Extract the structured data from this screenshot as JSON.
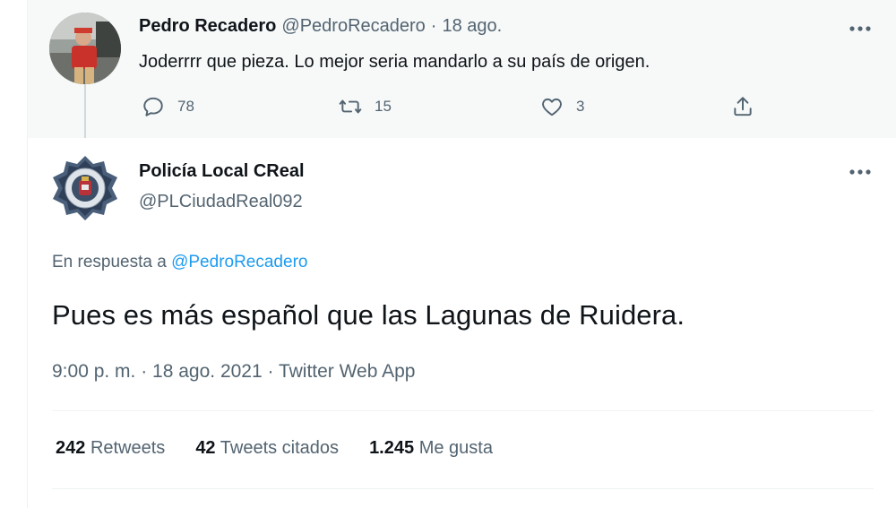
{
  "reply": {
    "author_name": "Pedro Recadero",
    "author_handle": "@PedroRecadero",
    "separator": "·",
    "date": "18 ago.",
    "text": "Joderrrr que pieza. Lo mejor seria mandarlo a su país de origen.",
    "reply_count": "78",
    "retweet_count": "15",
    "like_count": "3"
  },
  "tweet": {
    "author_name": "Policía Local CReal",
    "author_handle": "@PLCiudadReal092",
    "reply_prefix": "En respuesta a",
    "reply_mention": "@PedroRecadero",
    "text": "Pues es más español que las Lagunas de Ruidera.",
    "timestamp": "9:00 p. m. · 18 ago. 2021 · Twitter Web App",
    "stats": {
      "retweets_value": "242",
      "retweets_label": "Retweets",
      "quotes_value": "42",
      "quotes_label": "Tweets citados",
      "likes_value": "1.245",
      "likes_label": "Me gusta"
    }
  },
  "icons": {
    "reply": "comment-icon",
    "retweet": "retweet-icon",
    "like": "heart-icon",
    "share": "share-icon",
    "more": "more-icon"
  },
  "colors": {
    "accent": "#1d9bf0",
    "muted": "#536471",
    "text": "#0f1419",
    "reply_bg": "#f7f9f9"
  }
}
